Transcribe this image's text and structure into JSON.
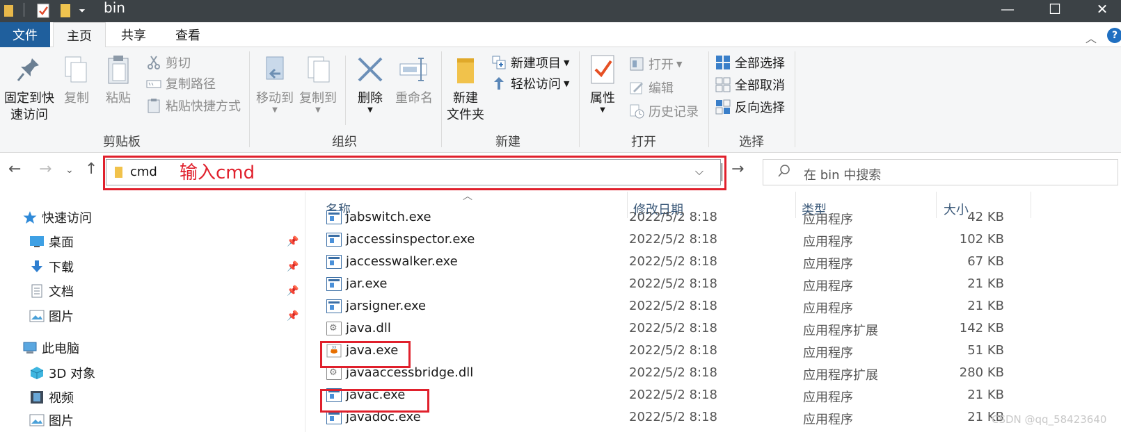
{
  "window": {
    "title": "bin"
  },
  "tabs": {
    "file": "文件",
    "home": "主页",
    "share": "共享",
    "view": "查看"
  },
  "ribbon": {
    "clipboard": {
      "label": "剪贴板",
      "pin": "固定到快\n速访问",
      "copy": "复制",
      "paste": "粘贴",
      "cut": "剪切",
      "copy_path": "复制路径",
      "paste_shortcut": "粘贴快捷方式"
    },
    "organize": {
      "label": "组织",
      "move_to": "移动到",
      "copy_to": "复制到",
      "delete": "删除",
      "rename": "重命名"
    },
    "new": {
      "label": "新建",
      "new_folder": "新建\n文件夹",
      "new_item": "新建项目",
      "easy_access": "轻松访问"
    },
    "open": {
      "label": "打开",
      "properties": "属性",
      "open": "打开",
      "edit": "编辑",
      "history": "历史记录"
    },
    "select": {
      "label": "选择",
      "select_all": "全部选择",
      "select_none": "全部取消",
      "invert": "反向选择"
    }
  },
  "address": {
    "value": "cmd",
    "annotation": "输入cmd"
  },
  "search": {
    "placeholder": "在 bin 中搜索"
  },
  "nav": {
    "quick_access": "快速访问",
    "desktop": "桌面",
    "downloads": "下载",
    "documents": "文档",
    "pictures": "图片",
    "this_pc": "此电脑",
    "objects3d": "3D 对象",
    "videos": "视频",
    "pictures2": "图片"
  },
  "columns": {
    "name": "名称",
    "date": "修改日期",
    "type": "类型",
    "size": "大小"
  },
  "files": [
    {
      "name": "jabswitch.exe",
      "date": "2022/5/2 8:18",
      "type": "应用程序",
      "size": "42 KB",
      "icon": "exe"
    },
    {
      "name": "jaccessinspector.exe",
      "date": "2022/5/2 8:18",
      "type": "应用程序",
      "size": "102 KB",
      "icon": "exe"
    },
    {
      "name": "jaccesswalker.exe",
      "date": "2022/5/2 8:18",
      "type": "应用程序",
      "size": "67 KB",
      "icon": "exe"
    },
    {
      "name": "jar.exe",
      "date": "2022/5/2 8:18",
      "type": "应用程序",
      "size": "21 KB",
      "icon": "exe"
    },
    {
      "name": "jarsigner.exe",
      "date": "2022/5/2 8:18",
      "type": "应用程序",
      "size": "21 KB",
      "icon": "exe"
    },
    {
      "name": "java.dll",
      "date": "2022/5/2 8:18",
      "type": "应用程序扩展",
      "size": "142 KB",
      "icon": "dll"
    },
    {
      "name": "java.exe",
      "date": "2022/5/2 8:18",
      "type": "应用程序",
      "size": "51 KB",
      "icon": "java"
    },
    {
      "name": "javaaccessbridge.dll",
      "date": "2022/5/2 8:18",
      "type": "应用程序扩展",
      "size": "280 KB",
      "icon": "dll"
    },
    {
      "name": "javac.exe",
      "date": "2022/5/2 8:18",
      "type": "应用程序",
      "size": "21 KB",
      "icon": "exe"
    },
    {
      "name": "javadoc.exe",
      "date": "2022/5/2 8:18",
      "type": "应用程序",
      "size": "21 KB",
      "icon": "exe"
    }
  ],
  "watermark": "CSDN @qq_58423640"
}
